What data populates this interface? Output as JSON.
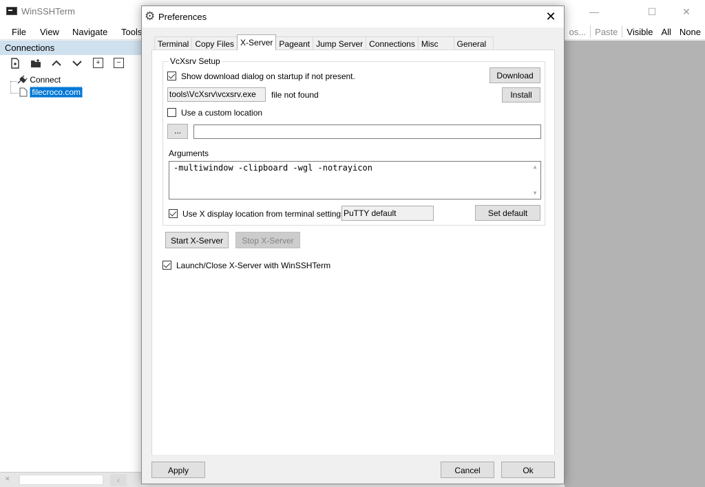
{
  "main_window": {
    "title": "WinSSHTerm",
    "menu": [
      "File",
      "View",
      "Navigate",
      "Tools"
    ],
    "right_toolbar": {
      "truncated": "os...",
      "paste": "Paste",
      "visible": "Visible",
      "all": "All",
      "none": "None"
    },
    "connections_header": "Connections",
    "tree": {
      "connect_label": "Connect",
      "selected_item": "filecroco.com"
    },
    "window_controls": {
      "minimize": "—",
      "maximize": "☐",
      "close": "✕"
    }
  },
  "dialog": {
    "title": "Preferences",
    "close_glyph": "✕",
    "tabs": [
      "Terminal",
      "Copy Files",
      "X-Server",
      "Pageant",
      "Jump Server",
      "Connections",
      "Misc",
      "General"
    ],
    "active_tab": "X-Server",
    "vcxsrv": {
      "group_title": "VcXsrv Setup",
      "show_download_label": "Show download dialog on startup if not present.",
      "show_download_checked": true,
      "download_button": "Download",
      "path_value": "tools\\VcXsrv\\vcxsrv.exe",
      "path_status": "file not found",
      "install_button": "Install",
      "custom_location_label": "Use a custom location",
      "custom_location_checked": false,
      "browse_button": "...",
      "custom_path_value": "",
      "arguments_label": "Arguments",
      "arguments_value": "-multiwindow -clipboard -wgl -notrayicon",
      "use_display_label": "Use X display location from terminal settings:",
      "use_display_checked": true,
      "display_value": "PuTTY default",
      "set_default_button": "Set default"
    },
    "start_button": "Start X-Server",
    "stop_button": "Stop X-Server",
    "launch_close_label": "Launch/Close X-Server with WinSSHTerm",
    "launch_close_checked": true,
    "footer": {
      "apply": "Apply",
      "cancel": "Cancel",
      "ok": "Ok"
    }
  }
}
